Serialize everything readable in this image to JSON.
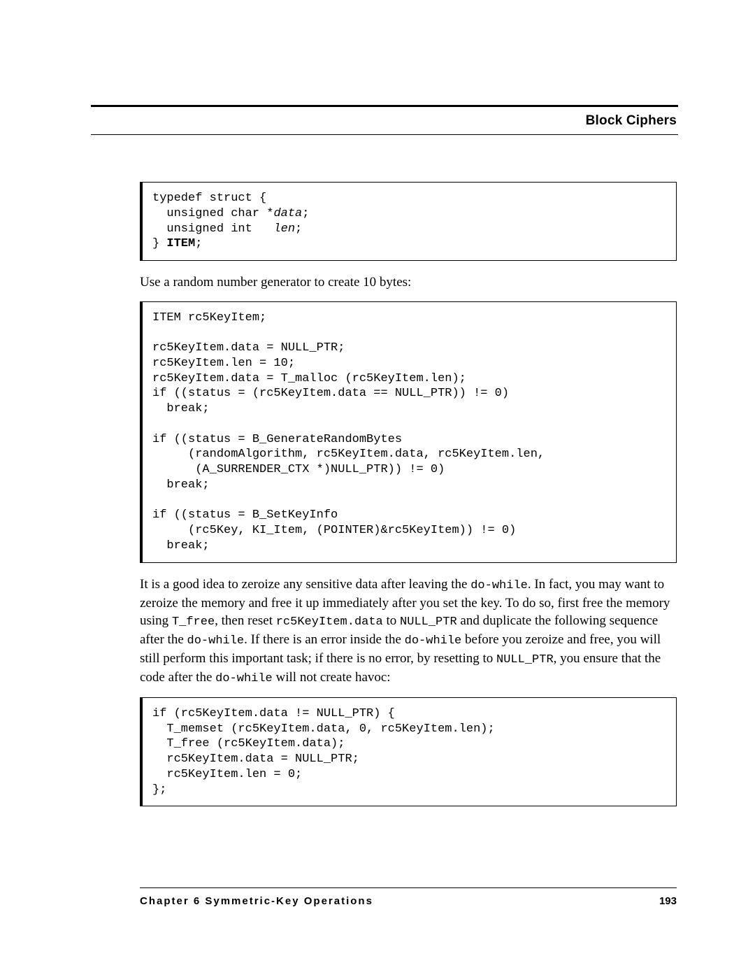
{
  "header": {
    "section_title": "Block Ciphers"
  },
  "footer": {
    "chapter_label": "Chapter 6  Symmetric-Key Operations",
    "page_number": "193"
  },
  "code": {
    "struct_line1": "typedef struct {",
    "struct_line2_a": "  unsigned char *",
    "struct_line2_b": "data",
    "struct_line2_c": ";",
    "struct_line3_a": "  unsigned int   ",
    "struct_line3_b": "len",
    "struct_line3_c": ";",
    "struct_line4_a": "} ",
    "struct_line4_b": "ITEM",
    "struct_line4_c": ";",
    "block2": "ITEM rc5KeyItem;\n\nrc5KeyItem.data = NULL_PTR;\nrc5KeyItem.len = 10;\nrc5KeyItem.data = T_malloc (rc5KeyItem.len);\nif ((status = (rc5KeyItem.data == NULL_PTR)) != 0)\n  break;\n\nif ((status = B_GenerateRandomBytes\n     (randomAlgorithm, rc5KeyItem.data, rc5KeyItem.len,\n      (A_SURRENDER_CTX *)NULL_PTR)) != 0)\n  break;\n\nif ((status = B_SetKeyInfo\n     (rc5Key, KI_Item, (POINTER)&rc5KeyItem)) != 0)\n  break;",
    "block3": "if (rc5KeyItem.data != NULL_PTR) {\n  T_memset (rc5KeyItem.data, 0, rc5KeyItem.len);\n  T_free (rc5KeyItem.data);\n  rc5KeyItem.data = NULL_PTR;\n  rc5KeyItem.len = 0;\n};"
  },
  "body": {
    "para1": "Use a random number generator to create 10 bytes:",
    "para2_a": "It is a good idea to zeroize any sensitive data after leaving the ",
    "para2_b": "do-while",
    "para2_c": ". In fact, you may want to zeroize the memory and free it up immediately after you set the key. To do so, first free the memory using ",
    "para2_d": "T_free",
    "para2_e": ", then reset ",
    "para2_f": "rc5KeyItem.data",
    "para2_g": " to ",
    "para2_h": "NULL_PTR",
    "para2_i": " and duplicate the following sequence after the ",
    "para2_j": "do-while",
    "para2_k": ". If there is an error inside the ",
    "para2_l": "do-while",
    "para2_m": " before you zeroize and free, you will still perform this important task; if there is no error, by resetting to ",
    "para2_n": "NULL_PTR",
    "para2_o": ", you ensure that the code after the ",
    "para2_p": "do-while",
    "para2_q": " will not create havoc:"
  }
}
